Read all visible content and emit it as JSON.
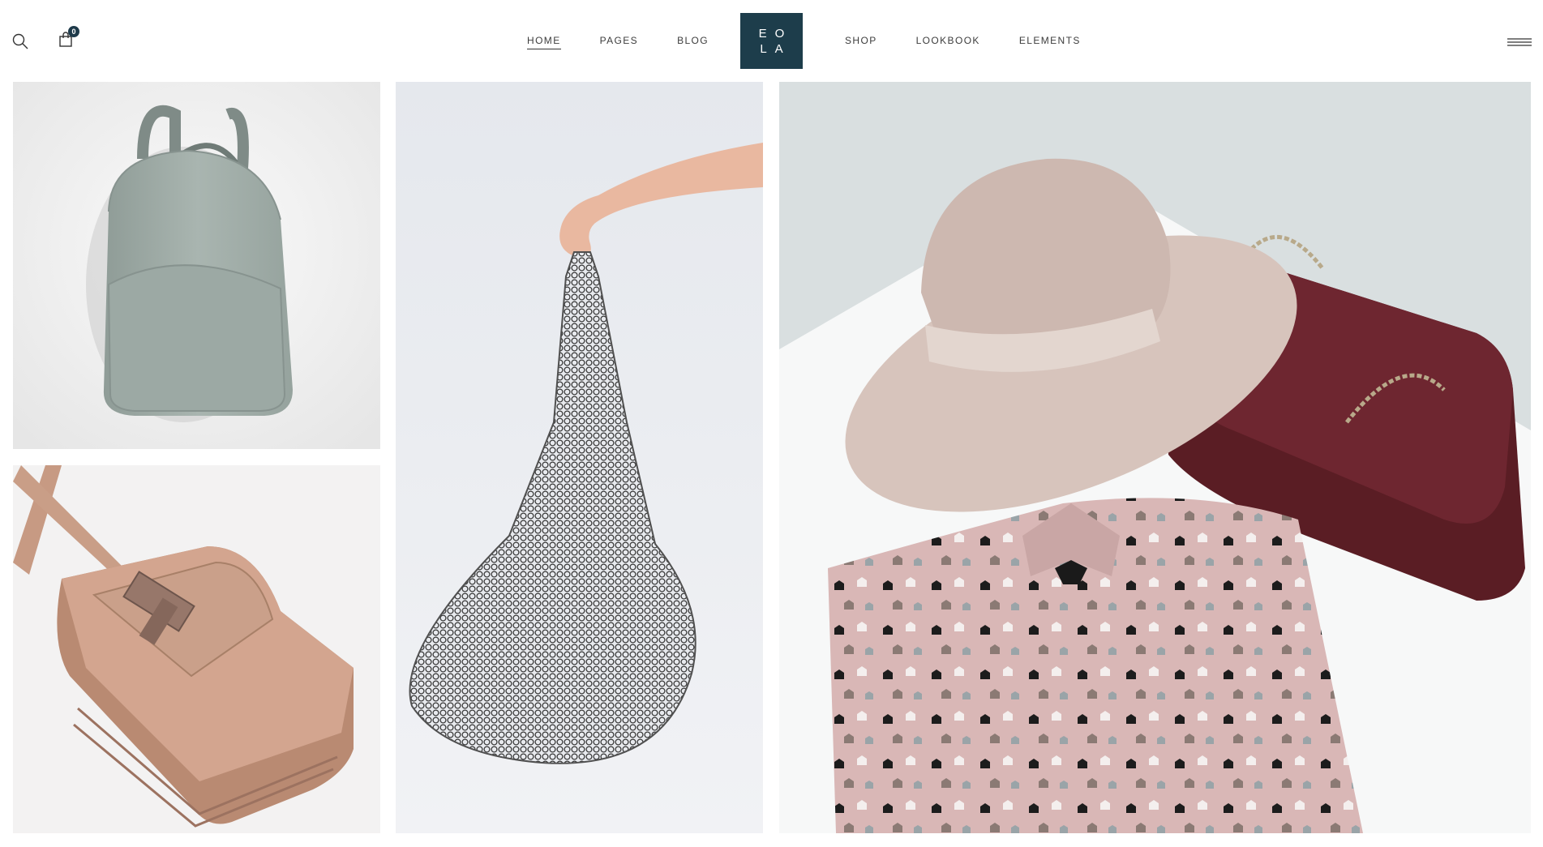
{
  "header": {
    "search_icon": "search-icon",
    "cart_icon": "shopping-bag-icon",
    "cart_count": "0",
    "menu_icon": "hamburger-menu-icon",
    "nav_left": [
      {
        "label": "HOME",
        "active": true
      },
      {
        "label": "PAGES",
        "active": false
      },
      {
        "label": "BLOG",
        "active": false
      }
    ],
    "nav_right": [
      {
        "label": "SHOP",
        "active": false
      },
      {
        "label": "LOOKBOOK",
        "active": false
      },
      {
        "label": "ELEMENTS",
        "active": false
      }
    ],
    "logo": {
      "line1": "EO",
      "line2": "LA",
      "color": "#1d3d4b"
    }
  },
  "gallery": {
    "tiles": [
      {
        "subject": "grey leather backpack"
      },
      {
        "subject": "tan leather crossbody bag"
      },
      {
        "subject": "hand holding mesh net bag"
      },
      {
        "subject": "felt hat, burgundy handbag and printed shirt"
      }
    ]
  }
}
